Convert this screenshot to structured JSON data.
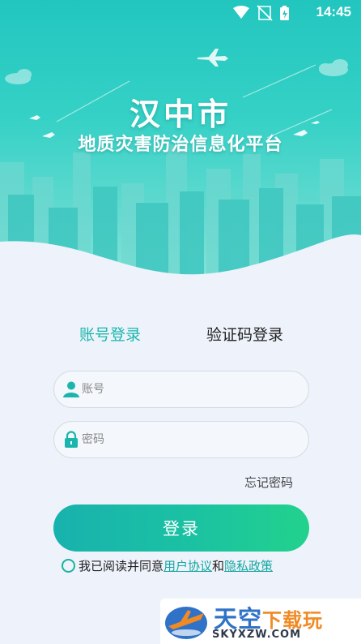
{
  "status_bar": {
    "time": "14:45"
  },
  "header": {
    "title": "汉中市",
    "subtitle": "地质灾害防治信息化平台"
  },
  "tabs": [
    {
      "label": "账号登录",
      "active": true
    },
    {
      "label": "验证码登录",
      "active": false
    }
  ],
  "form": {
    "account_placeholder": "账号",
    "password_placeholder": "密码",
    "forgot_password": "忘记密码",
    "login_button": "登录"
  },
  "agreement": {
    "prefix": "我已阅读并同意",
    "user_agreement": "用户协议",
    "and": "和",
    "privacy_policy": "隐私政策",
    "checked": false
  },
  "watermark": {
    "title_main": "天空",
    "title_alt": "下载玩",
    "url": "SKYXZW.COM"
  },
  "colors": {
    "accent": "#1ab6ad",
    "hero_top": "#22c6bf",
    "button_start": "#18b2ae",
    "button_end": "#22d28c"
  }
}
